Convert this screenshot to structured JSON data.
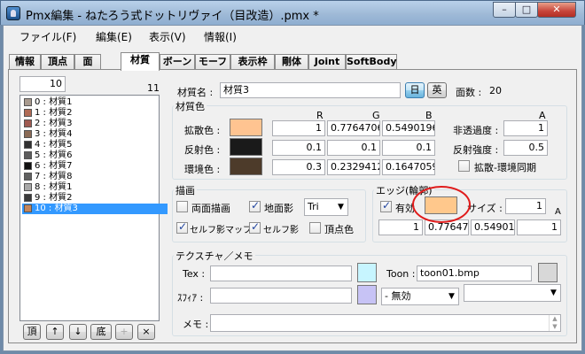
{
  "window": {
    "title": "Pmx編集 - ねたろう式ドットリヴァイ（目改造）.pmx *",
    "min": "–",
    "max": "□",
    "close": "✕"
  },
  "menu": [
    "ファイル(F)",
    "編集(E)",
    "表示(V)",
    "情報(I)"
  ],
  "tabs": [
    "情報",
    "頂点",
    "面",
    "材質",
    "ボーン",
    "モーフ",
    "表示枠",
    "剛体",
    "Joint",
    "SoftBody"
  ],
  "active_tab": "材質",
  "material_list": {
    "index_value": "10",
    "count": "11",
    "items": [
      {
        "label": "0 : 材質1",
        "color": "#a89a8e"
      },
      {
        "label": "1 : 材質2",
        "color": "#b06b55"
      },
      {
        "label": "2 : 材質3",
        "color": "#a05a50"
      },
      {
        "label": "3 : 材質4",
        "color": "#8a6a55"
      },
      {
        "label": "4 : 材質5",
        "color": "#303030"
      },
      {
        "label": "5 : 材質6",
        "color": "#5c5c5c"
      },
      {
        "label": "6 : 材質7",
        "color": "#101010"
      },
      {
        "label": "7 : 材質8",
        "color": "#606060"
      },
      {
        "label": "8 : 材質1",
        "color": "#a8a8a8"
      },
      {
        "label": "9 : 材質2",
        "color": "#3a3a3a"
      },
      {
        "label": "10 : 材質3",
        "color": "#c4855a",
        "selected": true
      }
    ],
    "buttons": [
      "頂",
      "↑",
      "↓",
      "底",
      "+",
      "×"
    ]
  },
  "material": {
    "name_label": "材質名 :",
    "name_value": "材質3",
    "lang_jp": "日",
    "lang_en": "英",
    "face_count_label": "面数 :",
    "face_count": "20"
  },
  "color_group": {
    "title": "材質色",
    "headers": {
      "r": "R",
      "g": "G",
      "b": "B",
      "a": "A"
    },
    "diffuse": {
      "label": "拡散色 :",
      "color": "#ffc491",
      "r": "1",
      "g": "0.7764706",
      "b": "0.5490196"
    },
    "specular": {
      "label": "反射色 :",
      "color": "#1a1a1a",
      "r": "0.1",
      "g": "0.1",
      "b": "0.1"
    },
    "ambient": {
      "label": "環境色 :",
      "color": "#4d3b2a",
      "r": "0.3",
      "g": "0.2329412",
      "b": "0.1647059"
    },
    "opacity_label": "非透過度 :",
    "opacity": "1",
    "spec_power_label": "反射強度 :",
    "spec_power": "0.5",
    "sync_label": "拡散-環境同期"
  },
  "draw_group": {
    "title": "描画",
    "double_sided": "両面描画",
    "ground_shadow": "地面影",
    "primitive": "Tri",
    "self_shadow_map": "セルフ影マップ",
    "self_shadow": "セルフ影",
    "vertex_color": "頂点色"
  },
  "edge_group": {
    "title": "エッジ(輪郭)",
    "enabled_label": "有効",
    "color": "#ffc88c",
    "size_label": "サイズ :",
    "size": "1",
    "a_header": "A",
    "r": "1",
    "g": "0.776470",
    "b": "0.549019",
    "a": "1"
  },
  "texture_group": {
    "title": "テクスチャ／メモ",
    "tex_label": "Tex :",
    "tex_value": "",
    "tex_swatch": "#c7f5ff",
    "toon_label": "Toon :",
    "toon_value": "toon01.bmp",
    "toon_swatch": "#d8d8d8",
    "sphere_label": "ｽﾌｨｱ :",
    "sphere_value": "",
    "sphere_swatch": "#c7c3f5",
    "sphere_mode": "- 無効",
    "sphere_combo2": "",
    "memo_label": "メモ :",
    "memo_value": ""
  }
}
